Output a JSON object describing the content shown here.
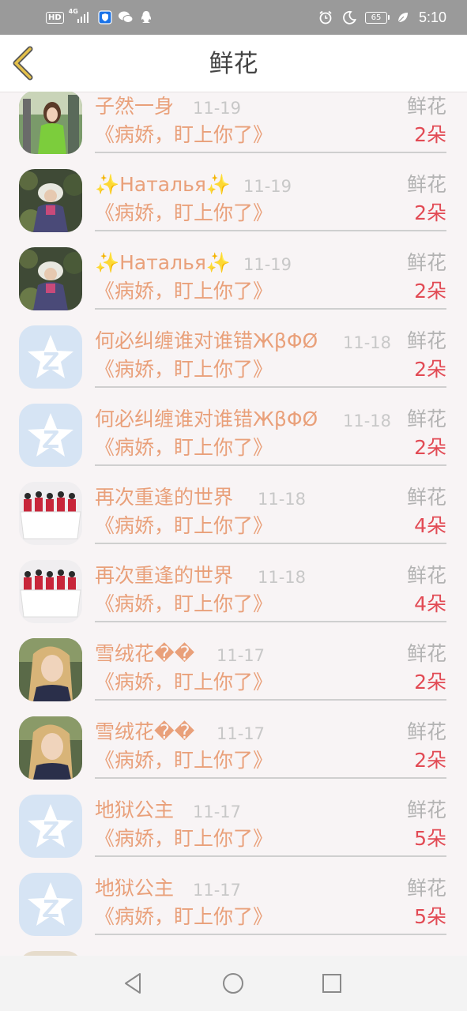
{
  "status_bar": {
    "left_badges": [
      "HD",
      "4G"
    ],
    "battery": "65",
    "time": "5:10",
    "icons": [
      "hd-icon",
      "signal-icon",
      "shield-app-icon",
      "wechat-icon",
      "qq-icon",
      "alarm-icon",
      "moon-icon",
      "battery-icon",
      "leaf-icon"
    ]
  },
  "header": {
    "title": "鲜花",
    "back_icon": "chevron-left-icon",
    "accent": "#e4c04a"
  },
  "rows": [
    {
      "name": "子然一身",
      "date": "11-19",
      "type": "鲜花",
      "book": "《病娇，盯上你了》",
      "count": "2朵",
      "avatar": "green-dress-photo"
    },
    {
      "name": "✨Наталья✨",
      "date": "11-19",
      "type": "鲜花",
      "book": "《病娇，盯上你了》",
      "count": "2朵",
      "avatar": "hat-girl-photo"
    },
    {
      "name": "✨Наталья✨",
      "date": "11-19",
      "type": "鲜花",
      "book": "《病娇，盯上你了》",
      "count": "2朵",
      "avatar": "hat-girl-photo"
    },
    {
      "name": "何必纠缠谁对谁错ЖβΦØ",
      "date": "11-18",
      "type": "鲜花",
      "book": "《病娇，盯上你了》",
      "count": "2朵",
      "avatar": "default-star-avatar"
    },
    {
      "name": "何必纠缠谁对谁错ЖβΦØ",
      "date": "11-18",
      "type": "鲜花",
      "book": "《病娇，盯上你了》",
      "count": "2朵",
      "avatar": "default-star-avatar"
    },
    {
      "name": "再次重逢的世界",
      "date": "11-18",
      "type": "鲜花",
      "book": "《病娇，盯上你了》",
      "count": "4朵",
      "avatar": "dancers-photo"
    },
    {
      "name": "再次重逢的世界",
      "date": "11-18",
      "type": "鲜花",
      "book": "《病娇，盯上你了》",
      "count": "4朵",
      "avatar": "dancers-photo"
    },
    {
      "name": "雪绒花��",
      "date": "11-17",
      "type": "鲜花",
      "book": "《病娇，盯上你了》",
      "count": "2朵",
      "avatar": "blonde-girl-photo"
    },
    {
      "name": "雪绒花��",
      "date": "11-17",
      "type": "鲜花",
      "book": "《病娇，盯上你了》",
      "count": "2朵",
      "avatar": "blonde-girl-photo"
    },
    {
      "name": "地狱公主",
      "date": "11-17",
      "type": "鲜花",
      "book": "《病娇，盯上你了》",
      "count": "5朵",
      "avatar": "default-star-avatar"
    },
    {
      "name": "地狱公主",
      "date": "11-17",
      "type": "鲜花",
      "book": "《病娇，盯上你了》",
      "count": "5朵",
      "avatar": "default-star-avatar"
    }
  ],
  "colors": {
    "name": "#e9a07a",
    "date": "#c8c8c8",
    "count": "#e24b55",
    "type": "#b3b3b3"
  },
  "nav": {
    "icons": [
      "back-triangle-icon",
      "home-circle-icon",
      "recents-square-icon"
    ]
  }
}
